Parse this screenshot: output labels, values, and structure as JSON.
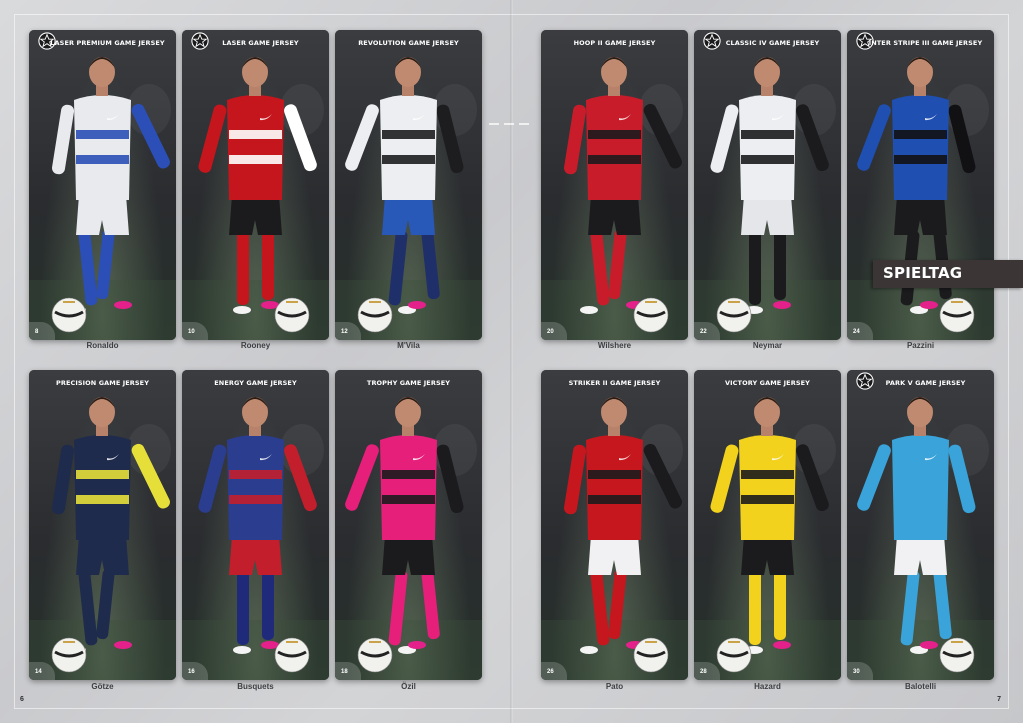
{
  "banner": {
    "label": "SPIELTAG"
  },
  "folios": {
    "left": "6",
    "right": "7"
  },
  "cards": [
    {
      "title": "LASER PREMIUM GAME JERSEY",
      "star": true,
      "page": "8",
      "player": "Ronaldo",
      "jersey": "#e9eaee",
      "accent": "#2b4fb6",
      "shorts": "#e9eaee",
      "socks": "#2b4fb6"
    },
    {
      "title": "LASER GAME JERSEY",
      "star": true,
      "page": "10",
      "player": "Rooney",
      "jersey": "#c4161c",
      "accent": "#ffffff",
      "shorts": "#1b1b1d",
      "socks": "#c4161c"
    },
    {
      "title": "REVOLUTION GAME JERSEY",
      "star": false,
      "page": "12",
      "player": "M'Vila",
      "jersey": "#eceef1",
      "accent": "#1d1d1f",
      "shorts": "#2858b8",
      "socks": "#1f2f6a"
    },
    {
      "title": "HOOP II GAME JERSEY",
      "star": false,
      "page": "20",
      "player": "Wilshere",
      "jersey": "#c91c2a",
      "accent": "#1b1b1d",
      "shorts": "#1b1b1d",
      "socks": "#c91c2a"
    },
    {
      "title": "CLASSIC IV GAME JERSEY",
      "star": true,
      "page": "22",
      "player": "Neymar",
      "jersey": "#eceef1",
      "accent": "#1b1b1d",
      "shorts": "#e5e6ea",
      "socks": "#1b1b1d"
    },
    {
      "title": "INTER STRIPE III GAME JERSEY",
      "star": true,
      "page": "24",
      "player": "Pazzini",
      "jersey": "#1f4fb0",
      "accent": "#111114",
      "shorts": "#1b1b1d",
      "socks": "#1b1b1d"
    },
    {
      "title": "PRECISION GAME JERSEY",
      "star": false,
      "page": "14",
      "player": "Götze",
      "jersey": "#1f2b4c",
      "accent": "#e6df3a",
      "shorts": "#1f2b4c",
      "socks": "#1f2b4c"
    },
    {
      "title": "ENERGY GAME JERSEY",
      "star": false,
      "page": "16",
      "player": "Busquets",
      "jersey": "#2a3d8e",
      "accent": "#c21e2c",
      "shorts": "#c21e2c",
      "socks": "#1f2b7a"
    },
    {
      "title": "TROPHY GAME JERSEY",
      "star": false,
      "page": "18",
      "player": "Özil",
      "jersey": "#e61f7b",
      "accent": "#1b1b1d",
      "shorts": "#1b1b1d",
      "socks": "#e61f7b"
    },
    {
      "title": "STRIKER II GAME JERSEY",
      "star": false,
      "page": "26",
      "player": "Pato",
      "jersey": "#c6161e",
      "accent": "#1b1b1d",
      "shorts": "#f1f1f3",
      "socks": "#c6161e"
    },
    {
      "title": "VICTORY GAME JERSEY",
      "star": false,
      "page": "28",
      "player": "Hazard",
      "jersey": "#f2d21c",
      "accent": "#1b1b1d",
      "shorts": "#1b1b1d",
      "socks": "#f2d21c"
    },
    {
      "title": "PARK V GAME JERSEY",
      "star": true,
      "page": "30",
      "player": "Balotelli",
      "jersey": "#3aa3d9",
      "accent": "#3aa3d9",
      "shorts": "#f1f1f3",
      "socks": "#3aa3d9"
    }
  ]
}
